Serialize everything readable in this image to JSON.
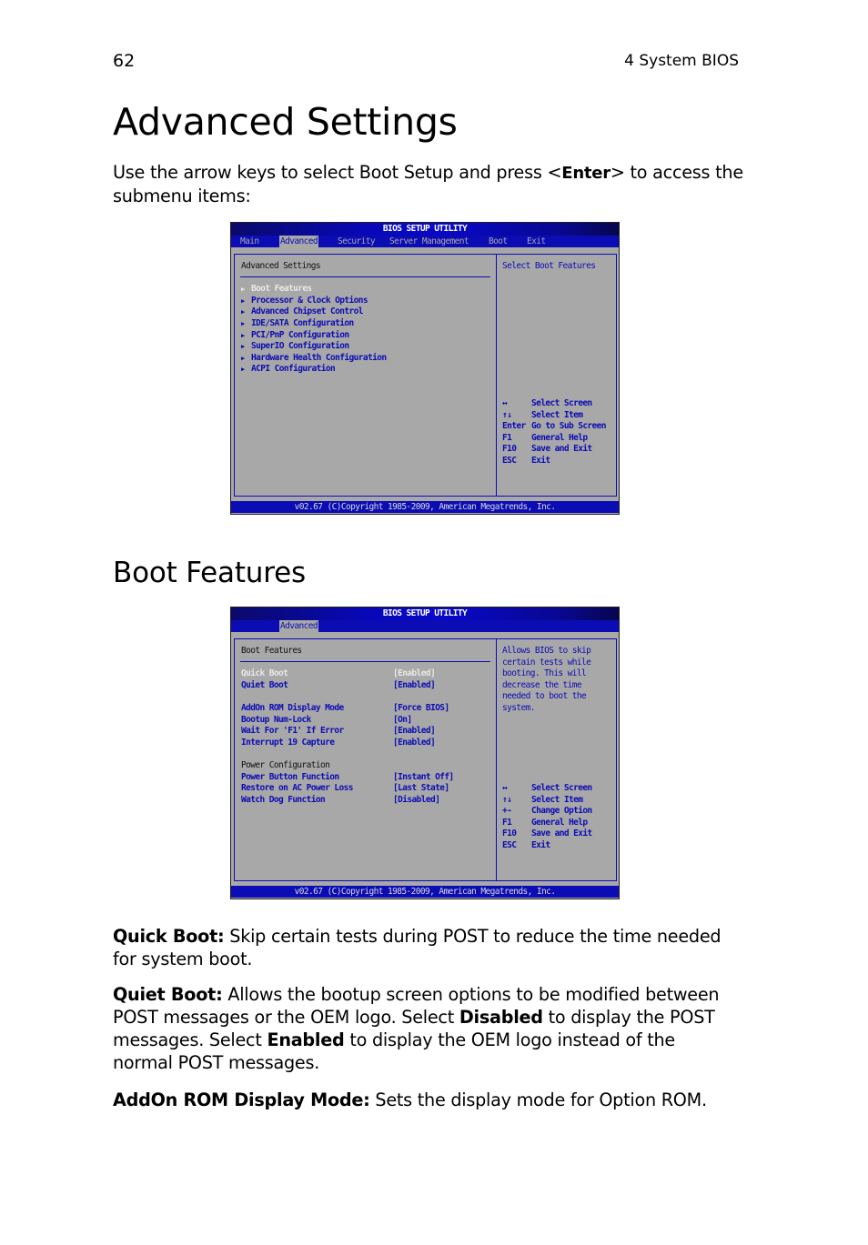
{
  "header": {
    "page_number": "62",
    "chapter": "4 System BIOS"
  },
  "section1": {
    "title": "Advanced Settings",
    "intro_pre": "Use the arrow keys to select Boot Setup and press <",
    "intro_key": "Enter",
    "intro_post": "> to access the",
    "intro_line2": "submenu items:"
  },
  "bios1": {
    "title": "BIOS SETUP UTILITY",
    "menu": [
      "Main",
      "Advanced",
      "Security",
      "Server Management",
      "Boot",
      "Exit"
    ],
    "active_menu": "Advanced",
    "heading": "Advanced Settings",
    "items": [
      "Boot Features",
      "Processor & Clock Options",
      "Advanced Chipset Control",
      "IDE/SATA Configuration",
      "PCI/PnP Configuration",
      "SuperIO Configuration",
      "Hardware Health Configuration",
      "ACPI Configuration"
    ],
    "help": "Select Boot Features",
    "keys": [
      {
        "key": "↔",
        "action": "Select Screen"
      },
      {
        "key": "↑↓",
        "action": "Select Item"
      },
      {
        "key": "Enter",
        "action": "Go to Sub Screen"
      },
      {
        "key": "F1",
        "action": "General Help"
      },
      {
        "key": "F10",
        "action": "Save and Exit"
      },
      {
        "key": "ESC",
        "action": "Exit"
      }
    ],
    "footer": "v02.67 (C)Copyright 1985-2009, American Megatrends, Inc."
  },
  "section2": {
    "title": "Boot Features"
  },
  "bios2": {
    "title": "BIOS SETUP UTILITY",
    "active_menu": "Advanced",
    "heading": "Boot Features",
    "settings": [
      {
        "label": "Quick Boot",
        "value": "[Enabled]",
        "selected": true
      },
      {
        "label": "Quiet Boot",
        "value": "[Enabled]"
      },
      {
        "label": "AddOn ROM Display Mode",
        "value": "[Force BIOS]"
      },
      {
        "label": "Bootup Num-Lock",
        "value": "[On]"
      },
      {
        "label": "Wait For 'F1' If Error",
        "value": "[Enabled]"
      },
      {
        "label": "Interrupt 19 Capture",
        "value": "[Enabled]"
      }
    ],
    "power_heading": "Power Configuration",
    "power_settings": [
      {
        "label": "Power Button Function",
        "value": "[Instant Off]"
      },
      {
        "label": "Restore on AC Power Loss",
        "value": "[Last State]"
      },
      {
        "label": "Watch Dog Function",
        "value": "[Disabled]"
      }
    ],
    "help_lines": [
      "Allows BIOS to skip",
      "certain tests while",
      "booting. This will",
      "decrease the time",
      "needed to boot the",
      "system."
    ],
    "keys": [
      {
        "key": "↔",
        "action": "Select Screen"
      },
      {
        "key": "↑↓",
        "action": "Select Item"
      },
      {
        "key": "+-",
        "action": "Change Option"
      },
      {
        "key": "F1",
        "action": "General Help"
      },
      {
        "key": "F10",
        "action": "Save and Exit"
      },
      {
        "key": "ESC",
        "action": "Exit"
      }
    ],
    "footer": "v02.67 (C)Copyright 1985-2009, American Megatrends, Inc."
  },
  "descriptions": {
    "quick_boot": {
      "term": "Quick Boot:",
      "line1": " Skip certain tests during POST to reduce the time needed",
      "line2": "for system boot."
    },
    "quiet_boot": {
      "term": "Quiet Boot:",
      "line1": " Allows the bootup screen options to be modified between",
      "line2_pre": "POST messages or the OEM logo. Select ",
      "line2_bold": "Disabled",
      "line2_post": " to display the POST",
      "line3_pre": "messages. Select ",
      "line3_bold": "Enabled",
      "line3_post": " to display the OEM logo instead of the",
      "line4": "normal POST messages."
    },
    "addon_rom": {
      "term": "AddOn ROM Display Mode:",
      "text": " Sets the display mode for Option ROM."
    }
  }
}
